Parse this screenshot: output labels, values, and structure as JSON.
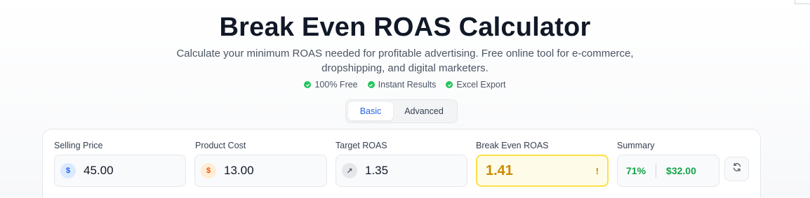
{
  "header": {
    "title": "Break Even ROAS Calculator",
    "subtitle": "Calculate your minimum ROAS needed for profitable advertising. Free online tool for e-commerce, dropshipping, and digital marketers."
  },
  "features": [
    {
      "label": "100% Free",
      "icon": "check-circle-icon"
    },
    {
      "label": "Instant Results",
      "icon": "check-circle-icon"
    },
    {
      "label": "Excel Export",
      "icon": "check-circle-icon"
    }
  ],
  "tabs": [
    {
      "label": "Basic",
      "active": true
    },
    {
      "label": "Advanced",
      "active": false
    }
  ],
  "fields": {
    "selling_price": {
      "label": "Selling Price",
      "value": "45.00",
      "icon": "dollar-icon",
      "symbol": "$"
    },
    "product_cost": {
      "label": "Product Cost",
      "value": "13.00",
      "icon": "dollar-icon",
      "symbol": "$"
    },
    "target_roas": {
      "label": "Target ROAS",
      "value": "1.35",
      "icon": "trending-up-icon",
      "symbol": "↗"
    },
    "break_even": {
      "label": "Break Even ROAS",
      "value": "1.41",
      "alert": "!"
    },
    "summary": {
      "label": "Summary",
      "margin": "71%",
      "profit": "$32.00"
    }
  },
  "colors": {
    "accent": "#2563eb",
    "success": "#16a34a",
    "warning": "#ca8a04",
    "highlight_border": "#fde047"
  }
}
